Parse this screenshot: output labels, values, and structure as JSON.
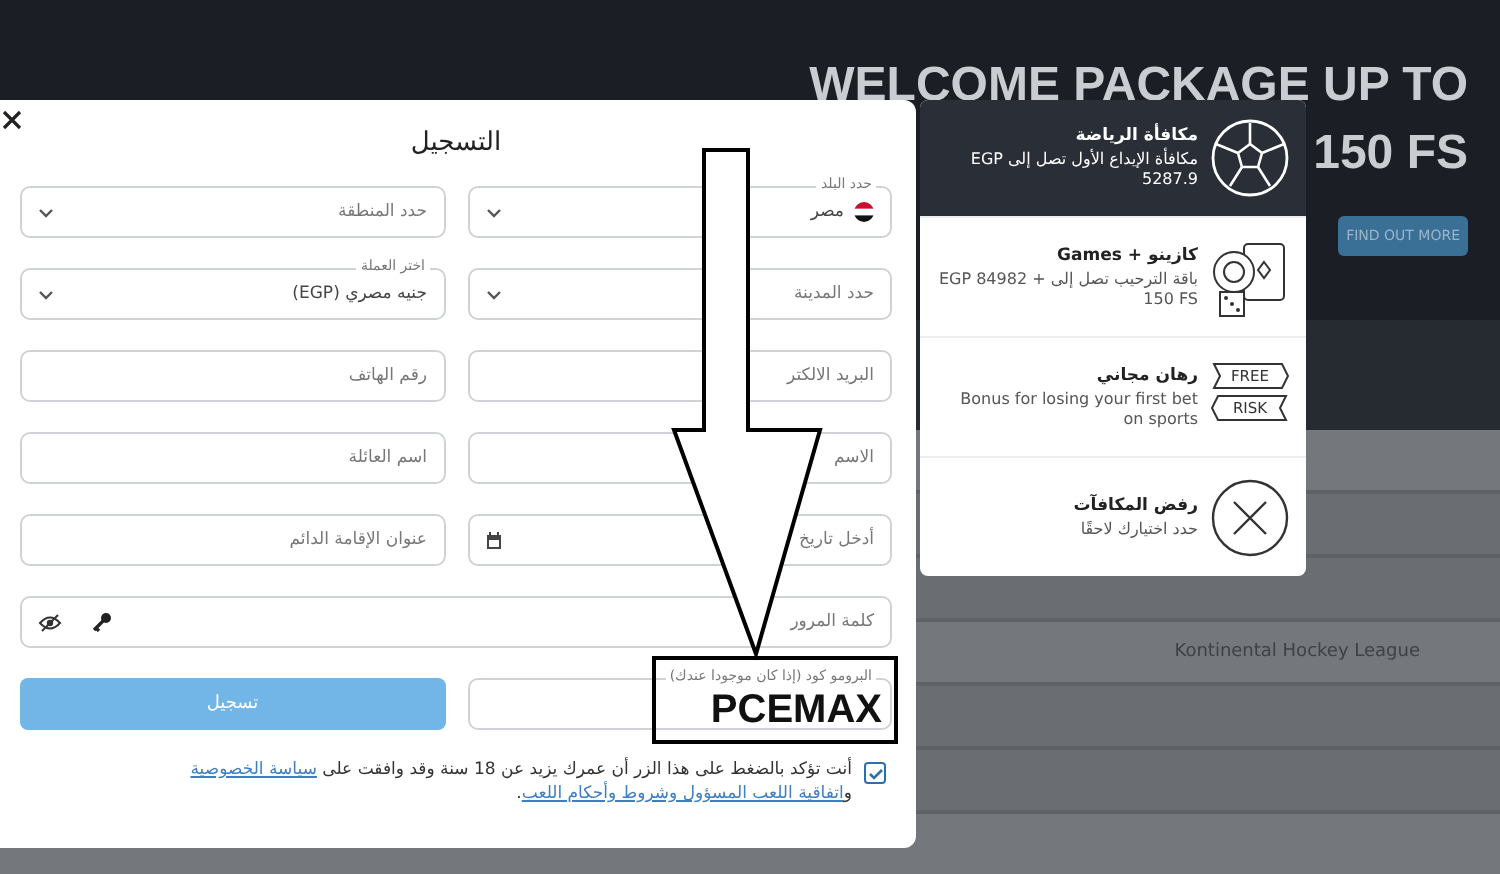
{
  "background_page": {
    "banner_title": "WELCOME PACKAGE UP TO",
    "banner_amount": "150 FS",
    "banner_button": "FIND OUT MORE",
    "league": "Kontinental Hockey League"
  },
  "registration": {
    "title": "التسجيل",
    "rows": [
      {
        "fields": [
          {
            "kind": "select",
            "label": "حدد البلد",
            "value": "مصر"
          },
          {
            "kind": "select",
            "placeholder": "حدد المنطقة"
          }
        ]
      },
      {
        "fields": [
          {
            "kind": "select",
            "placeholder": "حدد المدينة"
          },
          {
            "kind": "select",
            "label": "اختر العملة",
            "value": "جنيه مصري (EGP)"
          }
        ]
      },
      {
        "fields": [
          {
            "kind": "text",
            "placeholder": "البريد الالكتر"
          },
          {
            "kind": "text",
            "placeholder": "رقم الهاتف"
          }
        ]
      },
      {
        "fields": [
          {
            "kind": "text",
            "placeholder": "الاسم"
          },
          {
            "kind": "text",
            "placeholder": "اسم العائلة"
          }
        ]
      },
      {
        "fields": [
          {
            "kind": "date",
            "placeholder": "أدخل تاريخ"
          },
          {
            "kind": "text",
            "placeholder": "عنوان الإقامة الدائم"
          }
        ]
      },
      {
        "fields": [
          {
            "kind": "password",
            "placeholder": "كلمة المرور"
          }
        ]
      },
      {
        "fields": [
          {
            "kind": "promo",
            "label": "البرومو كود (إذا كان موجودا عندك)"
          }
        ]
      }
    ],
    "submit": "تسجيل",
    "consent": {
      "checked": true,
      "parts": [
        {
          "kind": "text",
          "text": "أنت تؤكد بالضغط على هذا الزر أن عمرك يزيد عن 18 سنة وقد وافقت على "
        },
        {
          "kind": "link",
          "text": "سياسة الخصوصية"
        },
        {
          "kind": "text",
          "text": " و"
        },
        {
          "kind": "link",
          "text": "اتفاقية اللعب المسؤول وشروط وأحكام اللعب"
        },
        {
          "kind": "text",
          "text": "."
        }
      ]
    }
  },
  "bonus_panel": {
    "items": [
      {
        "kind": "sports",
        "title": "مكافأة الرياضة",
        "description": "مكافأة الإيداع الأول تصل إلى EGP 5287.9",
        "selected": true
      },
      {
        "kind": "casino",
        "title": "كازينو + Games",
        "description": "باقة الترحيب تصل إلى EGP 84982 + 150 FS",
        "selected": false
      },
      {
        "kind": "freebet",
        "icon_labels": [
          "FREE",
          "RISK"
        ],
        "title": "رهان مجاني",
        "description": "Bonus for losing your first bet on sports",
        "selected": false
      },
      {
        "kind": "decline",
        "title": "رفض المكافآت",
        "description": "حدد اختيارك لاحقًا",
        "selected": false
      }
    ]
  },
  "annotation": {
    "promo_code": "PCEMAX"
  }
}
